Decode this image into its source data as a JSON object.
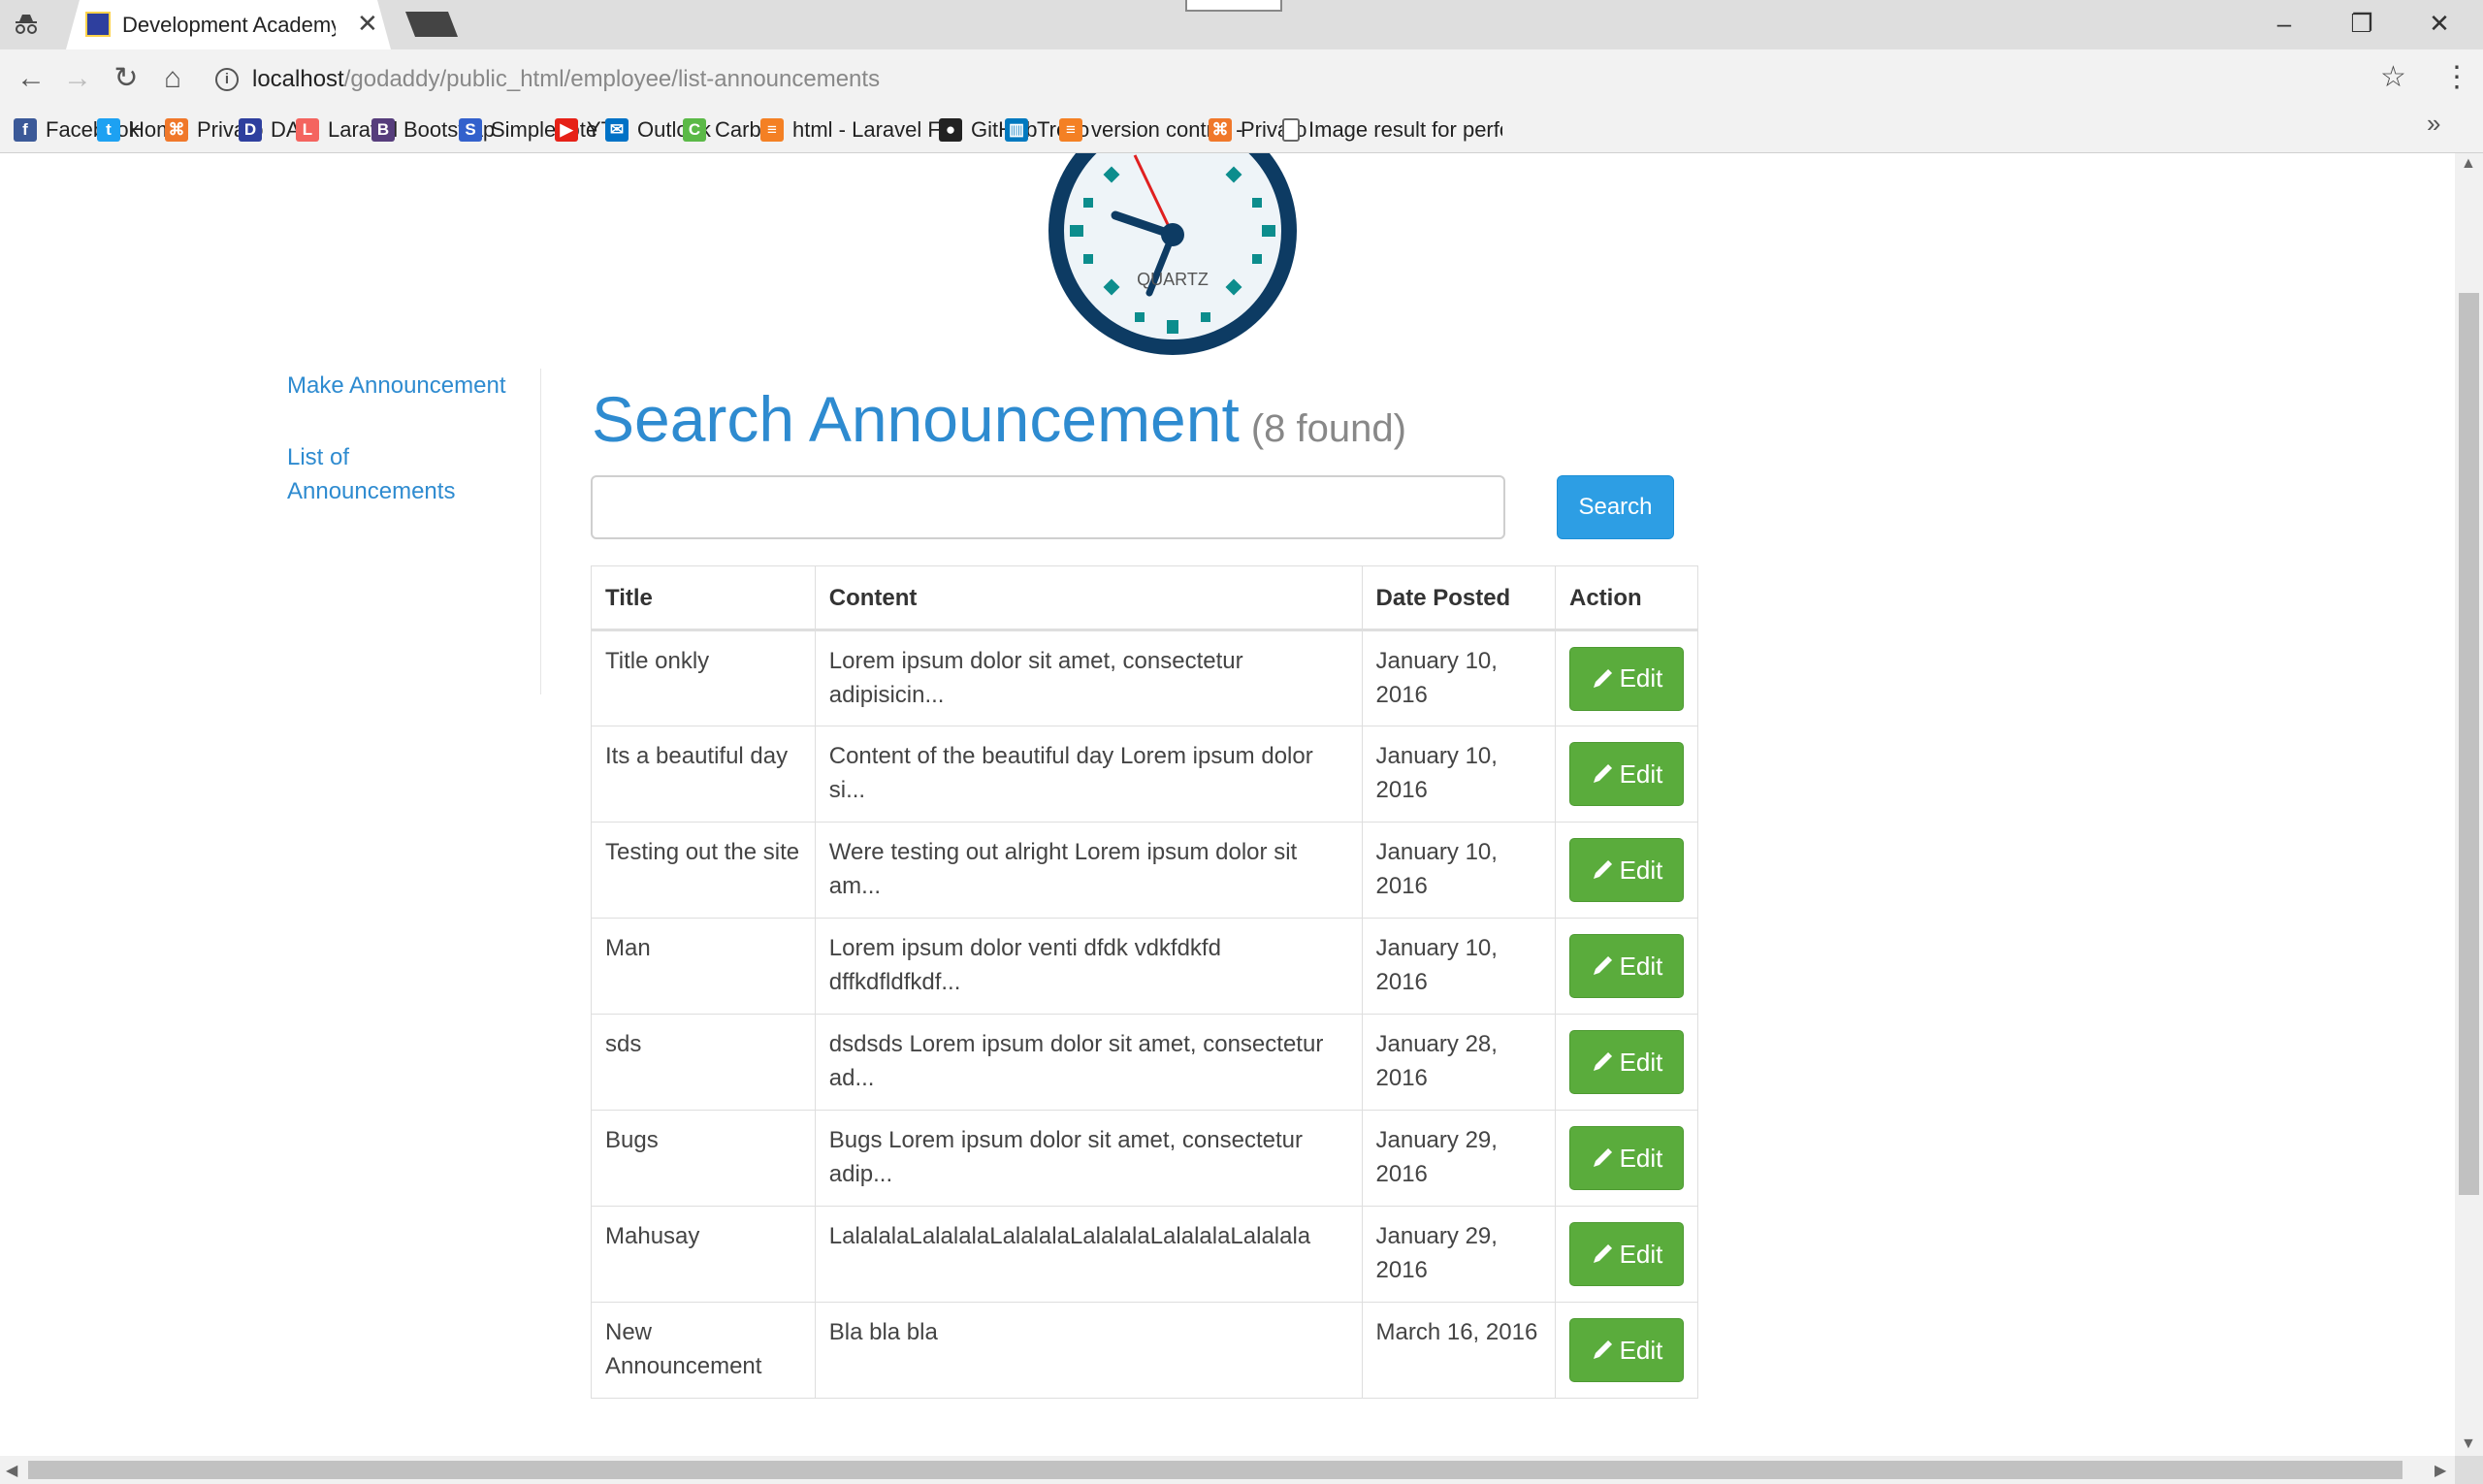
{
  "browser": {
    "tab_title": "Development Academy of the Philippines",
    "url_host": "localhost",
    "url_path": "/godaddy/public_html/employee/list-announcements",
    "bookmarks": [
      {
        "label": "Facebook",
        "icon": "facebook-icon",
        "color": "#3b5998",
        "glyph": "f"
      },
      {
        "label": "Home",
        "icon": "twitter-icon",
        "color": "#1da1f2",
        "glyph": "t"
      },
      {
        "label": "Privato",
        "icon": "privato-icon",
        "color": "#f0782a",
        "glyph": "⌘"
      },
      {
        "label": "DAP",
        "icon": "dap-icon",
        "color": "#2e3f9e",
        "glyph": "D"
      },
      {
        "label": "Laravel",
        "icon": "laravel-icon",
        "color": "#f4645f",
        "glyph": "L"
      },
      {
        "label": "Bootstrap",
        "icon": "bootstrap-icon",
        "color": "#563d7c",
        "glyph": "B"
      },
      {
        "label": "Simplenote",
        "icon": "simplenote-icon",
        "color": "#3361cc",
        "glyph": "S"
      },
      {
        "label": "YT",
        "icon": "youtube-icon",
        "color": "#e62117",
        "glyph": "▶"
      },
      {
        "label": "Outlook",
        "icon": "outlook-icon",
        "color": "#0072c6",
        "glyph": "✉"
      },
      {
        "label": "Carbon",
        "icon": "carbon-icon",
        "color": "#5bb947",
        "glyph": "C"
      },
      {
        "label": "html - Laravel Form b",
        "icon": "stackoverflow-icon",
        "color": "#f48024",
        "glyph": "≡"
      },
      {
        "label": "GitHub",
        "icon": "github-icon",
        "color": "#222222",
        "glyph": "●"
      },
      {
        "label": "Trello",
        "icon": "trello-icon",
        "color": "#0079bf",
        "glyph": "▥"
      },
      {
        "label": "version control - Igno",
        "icon": "stackoverflow-icon",
        "color": "#f48024",
        "glyph": "≡"
      },
      {
        "label": "Privato",
        "icon": "privato-icon",
        "color": "#f0782a",
        "glyph": "⌘"
      },
      {
        "label": "Image result for perfo",
        "icon": "page-icon",
        "color": "#ffffff",
        "glyph": ""
      }
    ]
  },
  "clock": {
    "label": "QUARTZ"
  },
  "sidebar": {
    "make_announcement": "Make Announcement",
    "list_announcements": "List of Announcements"
  },
  "main": {
    "title": "Search Announcement",
    "count": "(8 found)",
    "search_value": "",
    "search_button": "Search",
    "columns": [
      "Title",
      "Content",
      "Date Posted",
      "Action"
    ],
    "edit_label": "Edit",
    "rows": [
      {
        "title": "Title onkly",
        "content": "Lorem ipsum dolor sit amet, consectetur adipisicin...",
        "date": "January 10, 2016"
      },
      {
        "title": "Its a beautiful day",
        "content": "Content of the beautiful day Lorem ipsum dolor si...",
        "date": "January 10, 2016"
      },
      {
        "title": "Testing out the site",
        "content": "Were testing out alright Lorem ipsum dolor sit am...",
        "date": "January 10, 2016"
      },
      {
        "title": "Man",
        "content": "Lorem ipsum dolor venti dfdk vdkfdkfd dffkdfldfkdf...",
        "date": "January 10, 2016"
      },
      {
        "title": "sds",
        "content": "dsdsds Lorem ipsum dolor sit amet, consectetur ad...",
        "date": "January 28, 2016"
      },
      {
        "title": "Bugs",
        "content": "Bugs Lorem ipsum dolor sit amet, consectetur adip...",
        "date": "January 29, 2016"
      },
      {
        "title": "Mahusay",
        "content": "LalalalaLalalalaLalalalaLalalalaLalalalaLalalala",
        "date": "January 29, 2016"
      },
      {
        "title": "New Announcement",
        "content": "Bla bla bla",
        "date": "March 16, 2016"
      }
    ]
  }
}
